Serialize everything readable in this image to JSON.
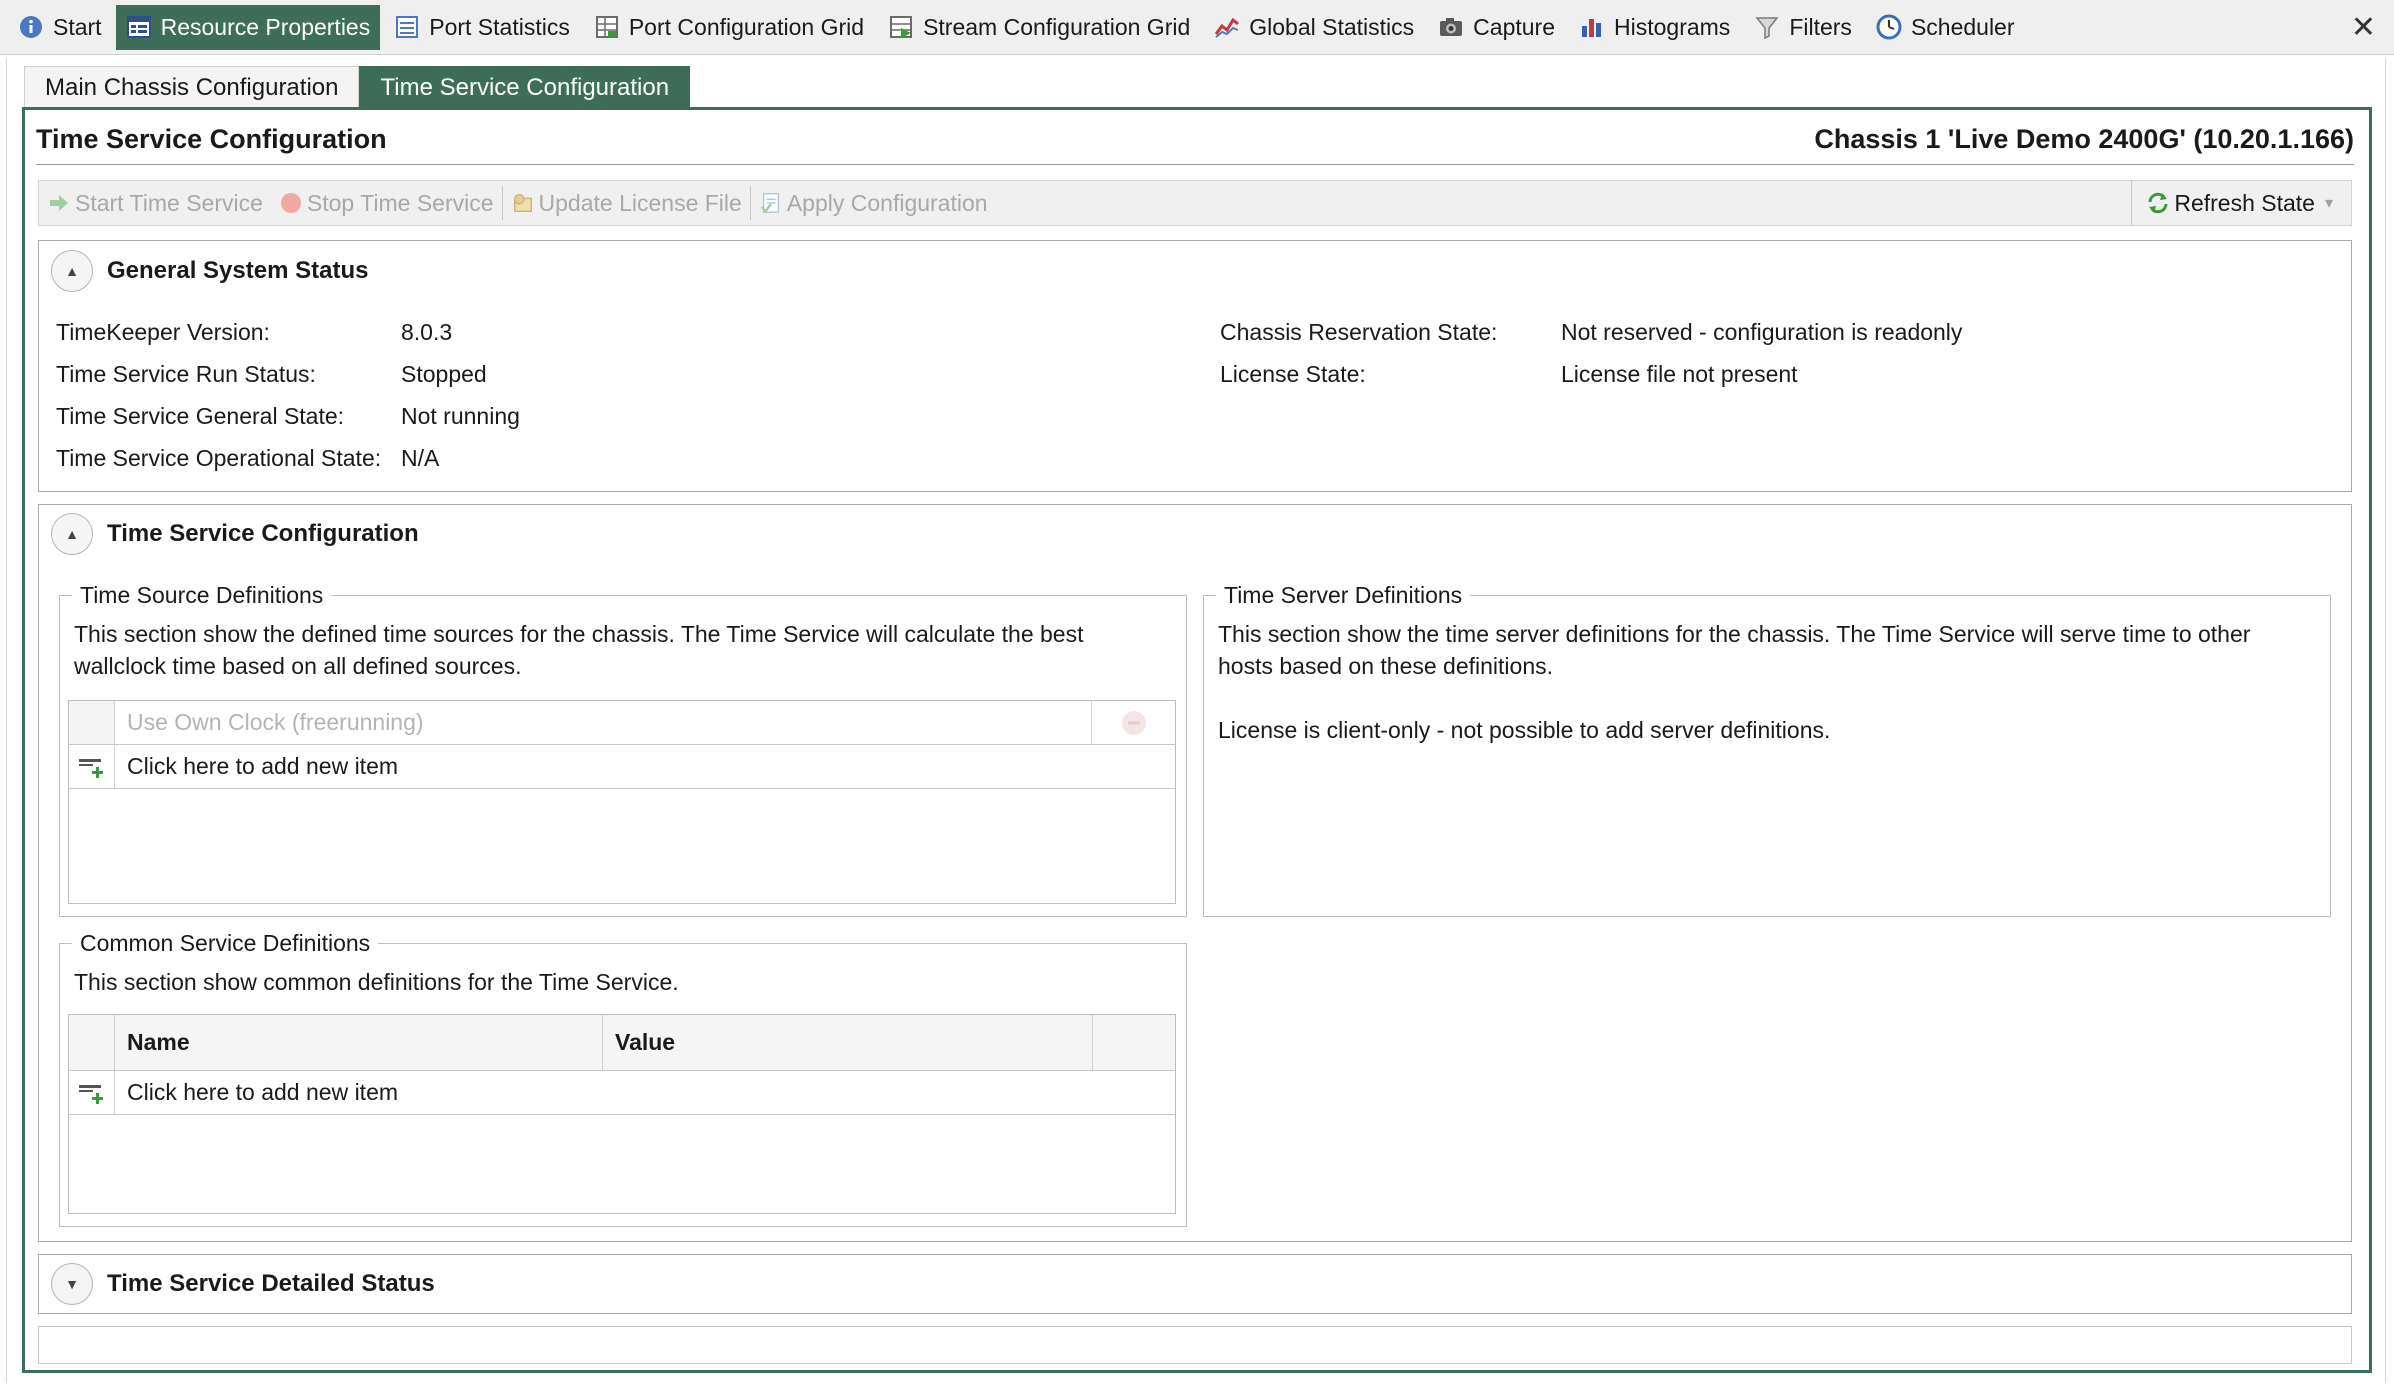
{
  "top_tabs": [
    {
      "label": "Start",
      "icon": "info-icon"
    },
    {
      "label": "Resource Properties",
      "icon": "properties-icon",
      "active": true
    },
    {
      "label": "Port Statistics",
      "icon": "statistics-icon"
    },
    {
      "label": "Port Configuration Grid",
      "icon": "grid-icon"
    },
    {
      "label": "Stream Configuration Grid",
      "icon": "stream-grid-icon"
    },
    {
      "label": "Global Statistics",
      "icon": "line-chart-icon"
    },
    {
      "label": "Capture",
      "icon": "camera-icon"
    },
    {
      "label": "Histograms",
      "icon": "bar-chart-icon"
    },
    {
      "label": "Filters",
      "icon": "filter-icon"
    },
    {
      "label": "Scheduler",
      "icon": "clock-icon"
    }
  ],
  "close_glyph": "✕",
  "sub_tabs": [
    {
      "label": "Main Chassis Configuration"
    },
    {
      "label": "Time Service Configuration",
      "active": true
    }
  ],
  "page": {
    "title": "Time Service Configuration",
    "chassis": "Chassis 1 'Live Demo 2400G' (10.20.1.166)"
  },
  "toolbar": {
    "start": "Start Time Service",
    "stop": "Stop Time Service",
    "update_license": "Update License File",
    "apply": "Apply Configuration",
    "refresh": "Refresh State"
  },
  "general_status": {
    "title": "General System Status",
    "left": [
      {
        "label": "TimeKeeper Version:",
        "value": "8.0.3"
      },
      {
        "label": "Time Service Run Status:",
        "value": "Stopped"
      },
      {
        "label": "Time Service General State:",
        "value": "Not running"
      },
      {
        "label": "Time Service Operational State:",
        "value": "N/A"
      }
    ],
    "right": [
      {
        "label": "Chassis Reservation State:",
        "value": "Not reserved - configuration is readonly"
      },
      {
        "label": "License State:",
        "value": "License file not present"
      }
    ]
  },
  "config": {
    "title": "Time Service Configuration",
    "sources": {
      "legend": "Time Source Definitions",
      "desc_line1": "This section show the defined time sources for the chassis. The Time Service will calculate the best",
      "desc_line2": "wallclock time based on all defined sources.",
      "row_placeholder": "Use Own Clock (freerunning)",
      "add_item": "Click here to add new item"
    },
    "servers": {
      "legend": "Time Server Definitions",
      "desc_line1": "This section show the time server definitions for the chassis. The Time Service will serve time to other",
      "desc_line2": "hosts based on these definitions.",
      "license_note": "License is client-only - not possible to add server definitions."
    },
    "common": {
      "legend": "Common Service Definitions",
      "desc": "This section show common definitions for the Time Service.",
      "col_name": "Name",
      "col_value": "Value",
      "add_item": "Click here to add new item"
    }
  },
  "detailed": {
    "title": "Time Service Detailed Status"
  },
  "colors": {
    "accent": "#3e6e5a",
    "disabled_text": "#a8a8a8"
  }
}
